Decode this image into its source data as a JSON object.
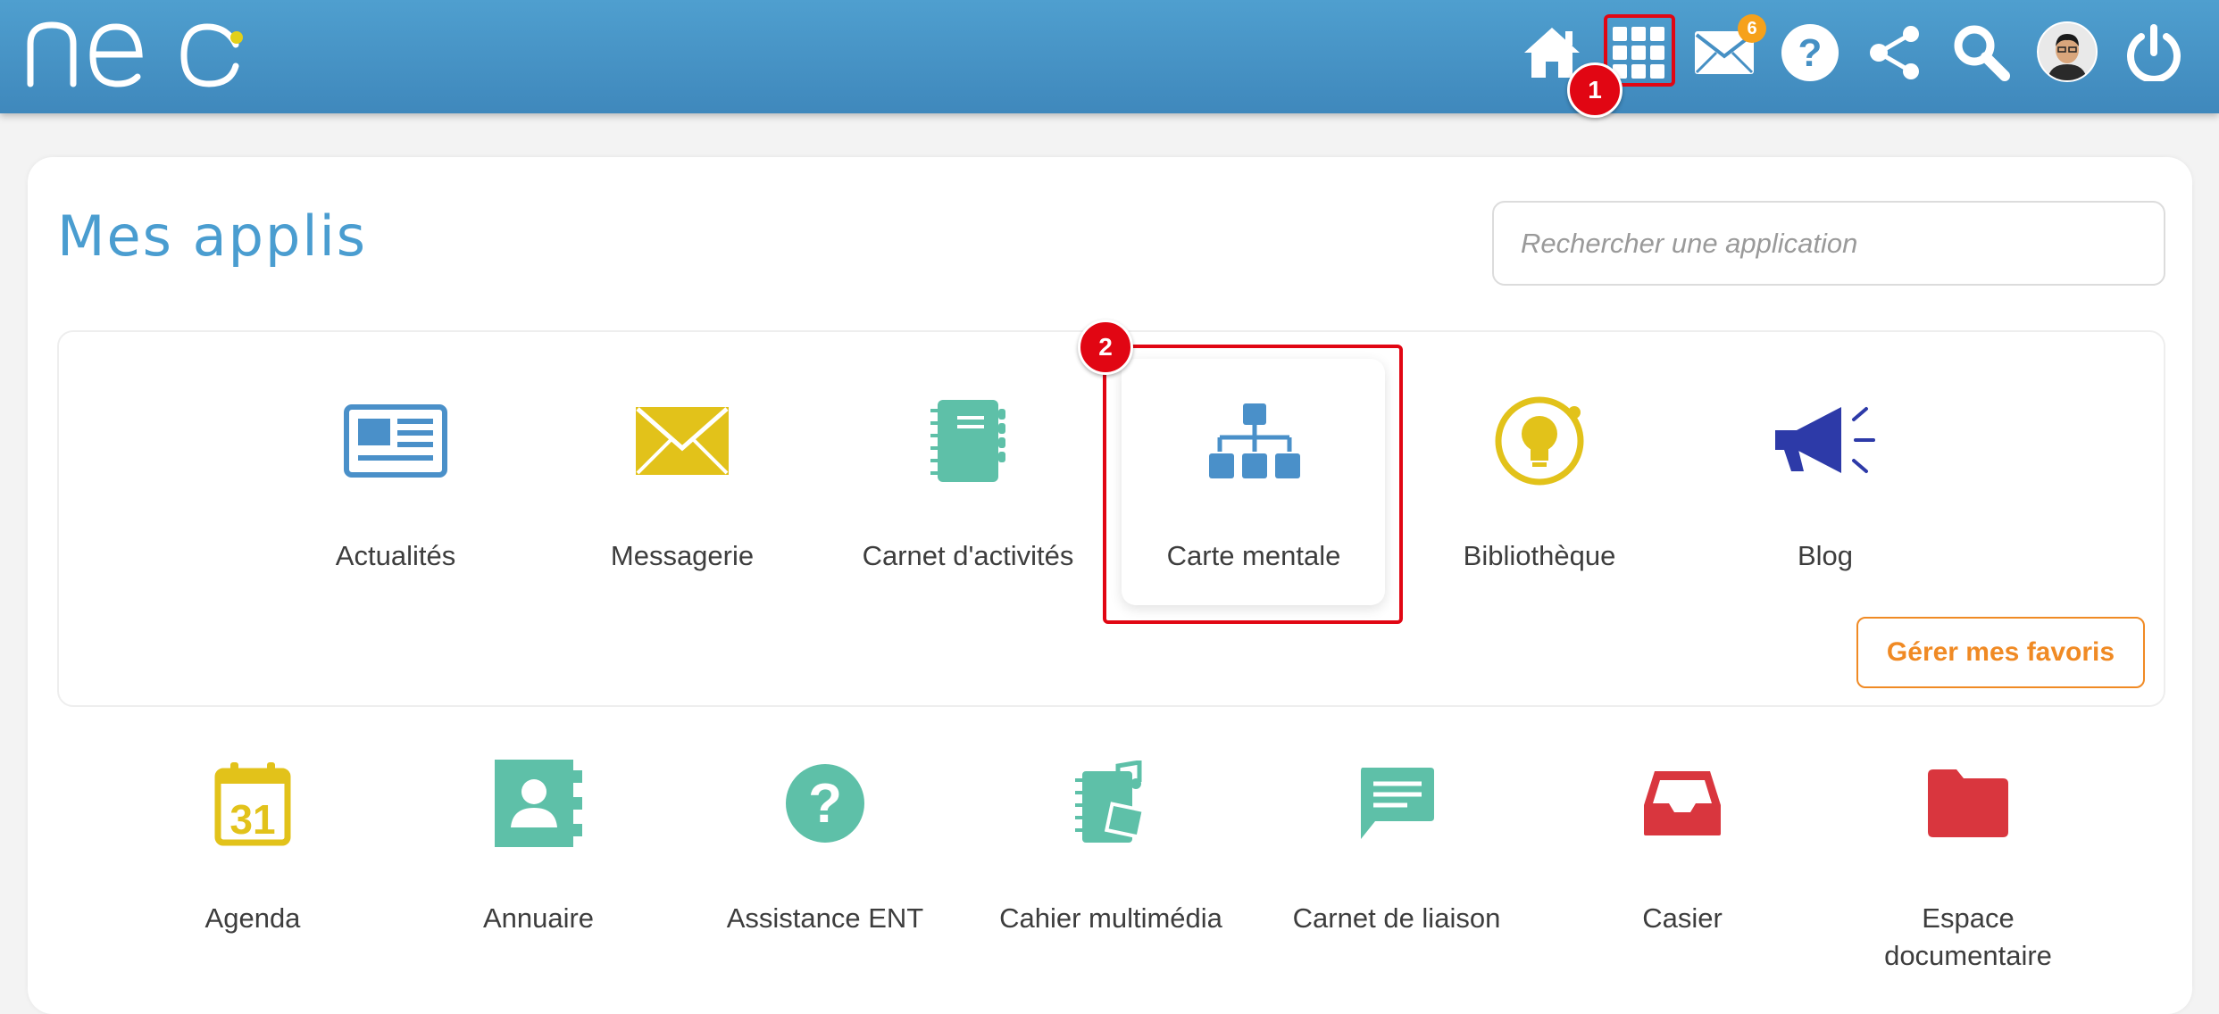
{
  "header": {
    "logo_alt": "neo",
    "mail_count": "6",
    "icons": [
      "home-icon",
      "apps-grid-icon",
      "mail-icon",
      "help-icon",
      "share-icon",
      "search-icon",
      "avatar",
      "power-icon"
    ]
  },
  "annotations": {
    "step1": "1",
    "step2": "2"
  },
  "page": {
    "title": "Mes applis",
    "search_placeholder": "Rechercher une application"
  },
  "favorites": [
    {
      "label": "Actualités",
      "icon": "newspaper-icon",
      "color": "#4a90c9"
    },
    {
      "label": "Messagerie",
      "icon": "envelope-icon",
      "color": "#e2c21a"
    },
    {
      "label": "Carnet d'activités",
      "icon": "notebook-icon",
      "color": "#5ec0a8"
    },
    {
      "label": "Carte mentale",
      "icon": "mindmap-icon",
      "color": "#4a90c9"
    },
    {
      "label": "Bibliothèque",
      "icon": "lightbulb-icon",
      "color": "#e2c21a"
    },
    {
      "label": "Blog",
      "icon": "megaphone-icon",
      "color": "#2d3aa8"
    }
  ],
  "manage_favorites_label": "Gérer mes favoris",
  "apps": [
    {
      "label": "Agenda",
      "icon": "calendar-icon",
      "color": "#e2c21a"
    },
    {
      "label": "Annuaire",
      "icon": "contact-book-icon",
      "color": "#5ec0a8"
    },
    {
      "label": "Assistance ENT",
      "icon": "question-circle-icon",
      "color": "#5ec0a8"
    },
    {
      "label": "Cahier multimédia",
      "icon": "multimedia-notebook-icon",
      "color": "#5ec0a8"
    },
    {
      "label": "Carnet de liaison",
      "icon": "chat-bubble-icon",
      "color": "#5ec0a8"
    },
    {
      "label": "Casier",
      "icon": "inbox-tray-icon",
      "color": "#d9363e"
    },
    {
      "label": "Espace\ndocumentaire",
      "icon": "folder-icon",
      "color": "#d9363e"
    }
  ]
}
